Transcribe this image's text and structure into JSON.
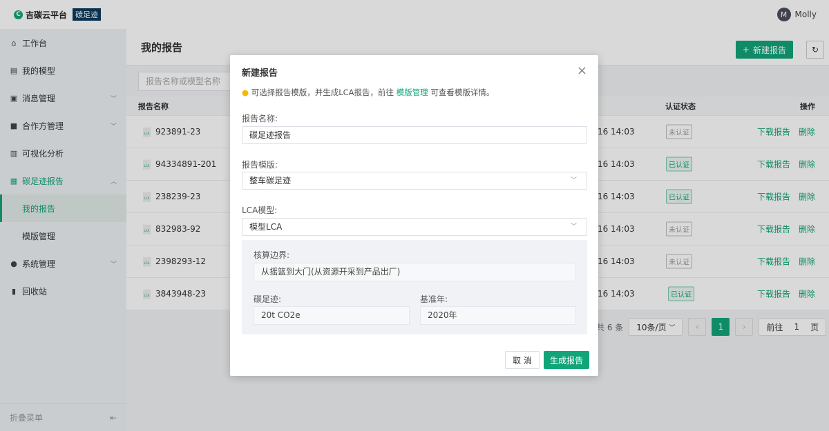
{
  "header": {
    "brand": "吉碳云平台",
    "product": "碳足迹",
    "user": "Molly",
    "avatar_letter": "M"
  },
  "sidebar": {
    "items": [
      {
        "label": "工作台",
        "icon": "home-icon"
      },
      {
        "label": "我的模型",
        "icon": "document-icon"
      },
      {
        "label": "消息管理",
        "icon": "inbox-icon"
      },
      {
        "label": "合作方管理",
        "icon": "briefcase-icon"
      },
      {
        "label": "可视化分析",
        "icon": "chart-icon"
      },
      {
        "label": "碳足迹报告",
        "icon": "report-icon"
      },
      {
        "label": "我的报告"
      },
      {
        "label": "模版管理"
      },
      {
        "label": "系统管理",
        "icon": "gear-icon"
      },
      {
        "label": "回收站",
        "icon": "trash-icon"
      }
    ],
    "fold_label": "折叠菜单"
  },
  "page": {
    "title": "我的报告",
    "new_button": "新建报告",
    "search_placeholder": "报告名称或模型名称"
  },
  "table": {
    "headers": {
      "name": "报告名称",
      "status": "认证状态",
      "actions": "操作"
    },
    "rows": [
      {
        "name": "923891-23",
        "time": "1-16  14:03",
        "status": "未认证",
        "verified": false
      },
      {
        "name": "94334891-201",
        "time": "1-16  14:03",
        "status": "已认证",
        "verified": true
      },
      {
        "name": "238239-23",
        "time": "1-16  14:03",
        "status": "已认证",
        "verified": true
      },
      {
        "name": "832983-92",
        "time": "1-16  14:03",
        "status": "未认证",
        "verified": false
      },
      {
        "name": "2398293-12",
        "time": "1-16  14:03",
        "status": "未认证",
        "verified": false
      },
      {
        "name": "3843948-23",
        "time": "1-16  14:03",
        "status": "已认证",
        "verified": true
      }
    ],
    "download": "下载报告",
    "delete": "删除"
  },
  "pagination": {
    "total": "共 6 条",
    "page_size": "10条/页",
    "current": "1",
    "goto_prefix": "前往",
    "goto_value": "1",
    "goto_suffix": "页"
  },
  "modal": {
    "title": "新建报告",
    "tip_before": "可选择报告模版，并生成LCA报告，前往",
    "tip_link": "模版管理",
    "tip_after": "可查看模版详情。",
    "name_label": "报告名称:",
    "name_value": "碳足迹报告",
    "template_label": "报告模版:",
    "template_value": "整车碳足迹",
    "model_label": "LCA模型:",
    "model_value": "模型LCA",
    "boundary_label": "核算边界:",
    "boundary_value": "从摇篮到大门(从资源开采到产品出厂)",
    "footprint_label": "碳足迹:",
    "footprint_value": "20t CO2e",
    "base_year_label": "基准年:",
    "base_year_value": "2020年",
    "cancel": "取 消",
    "generate": "生成报告"
  }
}
